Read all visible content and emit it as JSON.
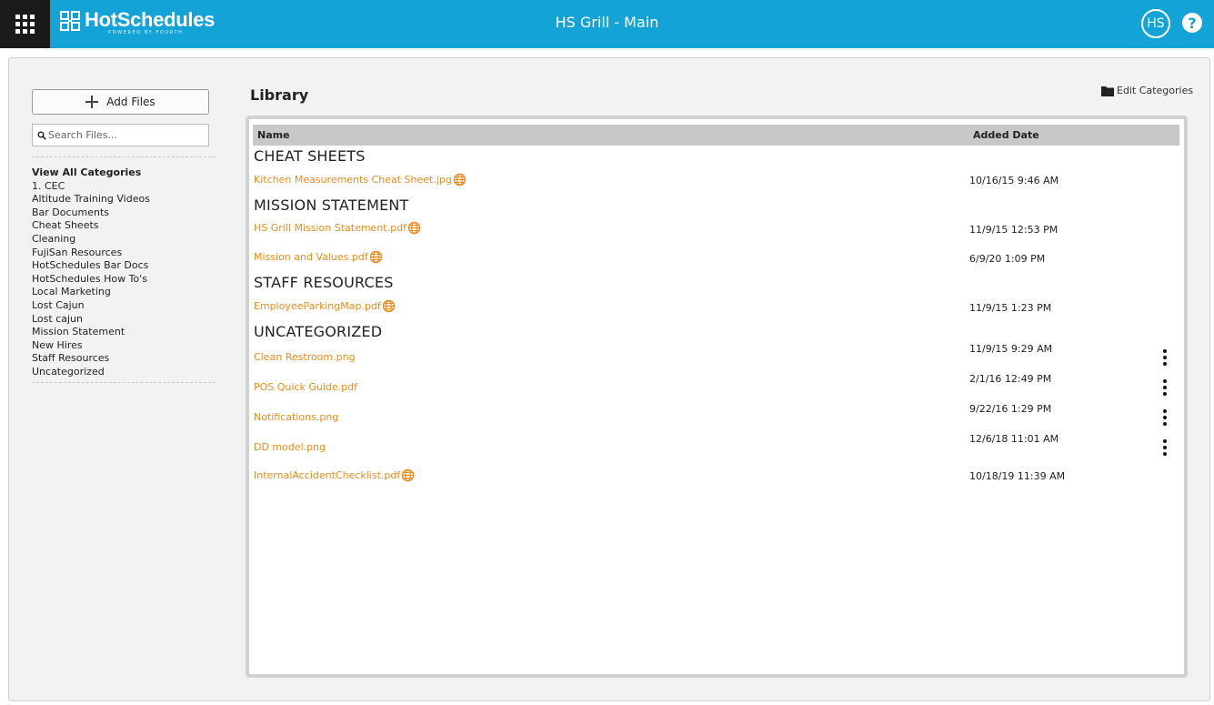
{
  "header": {
    "brand": "HotSchedules",
    "brand_tagline": "POWERED BY FOURTH",
    "location": "HS Grill - Main",
    "avatar_initials": "HS",
    "help_label": "?"
  },
  "sidebar": {
    "add_files_label": "Add Files",
    "search_placeholder": "Search Files...",
    "categories": [
      "View All Categories",
      "1. CEC",
      "Altitude Training Videos",
      "Bar Documents",
      "Cheat Sheets",
      "Cleaning",
      "FujiSan Resources",
      "HotSchedules Bar Docs",
      "HotSchedules How To's",
      "Local Marketing",
      "Lost Cajun",
      "Lost cajun",
      "Mission Statement",
      "New Hires",
      "Staff Resources",
      "Uncategorized"
    ]
  },
  "library": {
    "title": "Library",
    "edit_categories_label": "Edit Categories",
    "columns": {
      "name": "Name",
      "added_date": "Added Date"
    },
    "sections": [
      {
        "title": "CHEAT SHEETS"
      },
      {
        "title": "MISSION STATEMENT"
      },
      {
        "title": "STAFF RESOURCES"
      },
      {
        "title": "UNCATEGORIZED"
      }
    ],
    "files": [
      {
        "name": "Kitchen Measurements Cheat Sheet.jpg",
        "date": "10/16/15 9:46 AM",
        "shared": true
      },
      {
        "name": "HS Grill Mission Statement.pdf",
        "date": "11/9/15 12:53 PM",
        "shared": true
      },
      {
        "name": "Mission and Values.pdf",
        "date": "6/9/20 1:09 PM",
        "shared": true
      },
      {
        "name": "EmployeeParkingMap.pdf",
        "date": "11/9/15 1:23 PM",
        "shared": true
      },
      {
        "name": "Clean Restroom.png",
        "date": "11/9/15 9:29 AM",
        "shared": false
      },
      {
        "name": "POS Quick Guide.pdf",
        "date": "2/1/16 12:49 PM",
        "shared": false
      },
      {
        "name": "Notifications.png",
        "date": "9/22/16 1:29 PM",
        "shared": false
      },
      {
        "name": "DD model.png",
        "date": "12/6/18 11:01 AM",
        "shared": false
      },
      {
        "name": "InternalAccidentChecklist.pdf",
        "date": "10/18/19 11:39 AM",
        "shared": true
      }
    ]
  },
  "colors": {
    "header_bg": "#13a3d6",
    "link": "#f08a1a",
    "globe": "#f08a1a"
  },
  "icons": [
    "app-grid-icon",
    "hotschedules-logo-icon",
    "help-icon",
    "plus-icon",
    "search-icon",
    "folder-icon",
    "globe-icon",
    "kebab-menu-icon"
  ]
}
